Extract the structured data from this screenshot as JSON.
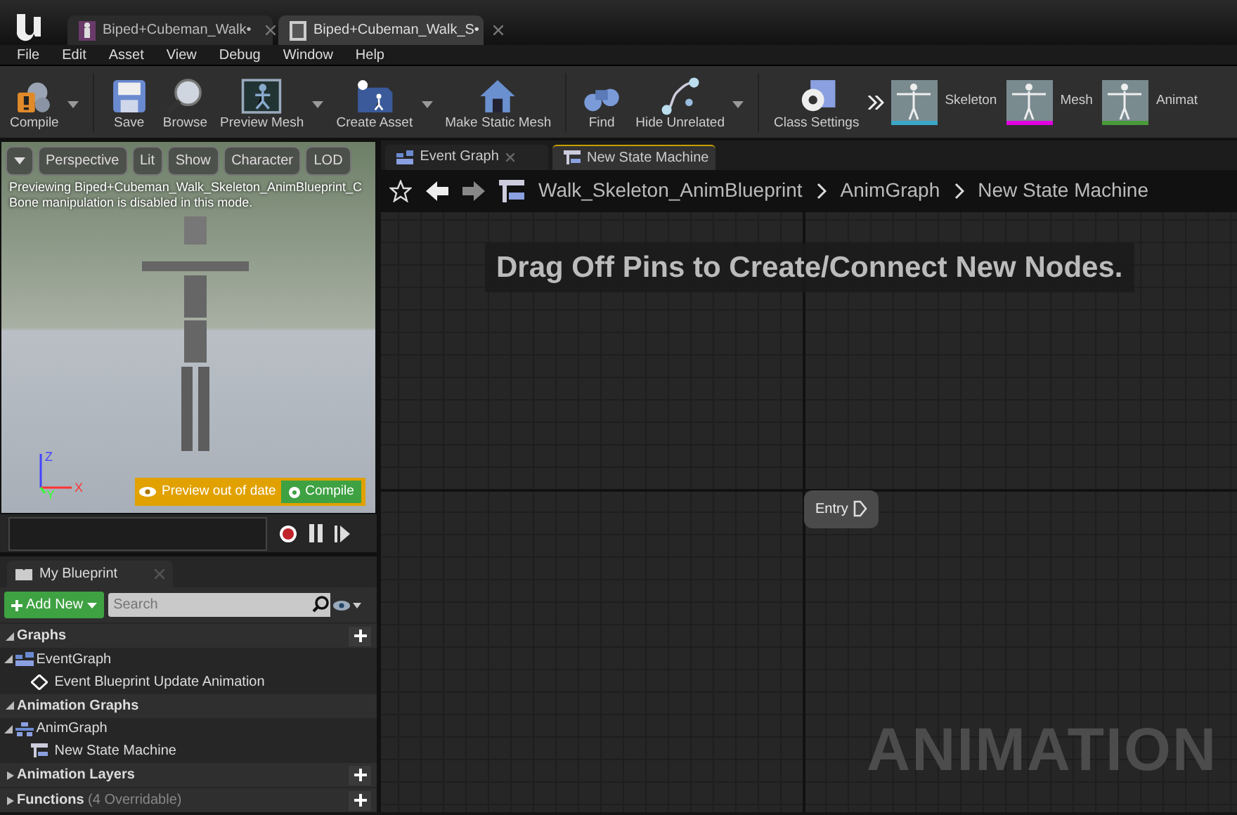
{
  "window": {
    "tabs": [
      {
        "label": "Biped+Cubeman_Walk",
        "modified_mark": "•",
        "selected": false
      },
      {
        "label": "Biped+Cubeman_Walk_S",
        "modified_mark": "•",
        "selected": true
      }
    ]
  },
  "menu": [
    "File",
    "Edit",
    "Asset",
    "View",
    "Debug",
    "Window",
    "Help"
  ],
  "toolbar": {
    "buttons": [
      {
        "label": "Compile",
        "dropdown": true
      },
      {
        "label": "Save",
        "dropdown": false
      },
      {
        "label": "Browse",
        "dropdown": false
      },
      {
        "label": "Preview Mesh",
        "dropdown": true
      },
      {
        "label": "Create Asset",
        "dropdown": true
      },
      {
        "label": "Make Static Mesh",
        "dropdown": false
      },
      {
        "label": "Find",
        "dropdown": false
      },
      {
        "label": "Hide Unrelated",
        "dropdown": true
      },
      {
        "label": "Class Settings",
        "dropdown": false
      }
    ],
    "modes": [
      {
        "label": "Skeleton",
        "color": "#3aa6c8"
      },
      {
        "label": "Mesh",
        "color": "#e000e0"
      },
      {
        "label": "Animat",
        "color": "#4a9a3a"
      }
    ]
  },
  "viewport": {
    "buttons": [
      {
        "label": "Perspective"
      },
      {
        "label": "Lit"
      },
      {
        "label": "Show"
      },
      {
        "label": "Character"
      },
      {
        "label": "LOD"
      }
    ],
    "messages": [
      "Previewing Biped+Cubeman_Walk_Skeleton_AnimBlueprint_C",
      "Bone manipulation is disabled in this mode."
    ],
    "axes": [
      "Z",
      "X",
      "Y"
    ],
    "warning": "Preview out of date",
    "compile_button": "Compile"
  },
  "my_blueprint": {
    "tab": "My Blueprint",
    "add_button": "Add New",
    "search": {
      "placeholder": "Search"
    },
    "sections": [
      {
        "label": "Graphs",
        "expanded": true,
        "addable": true,
        "children": [
          {
            "label": "EventGraph",
            "expanded": true,
            "children": [
              {
                "label": "Event Blueprint Update Animation"
              }
            ]
          }
        ]
      },
      {
        "label": "Animation Graphs",
        "expanded": true,
        "addable": false,
        "children": [
          {
            "label": "AnimGraph",
            "expanded": true,
            "children": [
              {
                "label": "New State Machine"
              }
            ]
          }
        ]
      },
      {
        "label": "Animation Layers",
        "expanded": false,
        "addable": true
      },
      {
        "label": "Functions",
        "note": "(4 Overridable)",
        "expanded": false,
        "addable": true
      }
    ]
  },
  "graph": {
    "tabs": [
      {
        "label": "Event Graph",
        "selected": false
      },
      {
        "label": "New State Machine",
        "selected": true
      }
    ],
    "breadcrumbs": [
      "Walk_Skeleton_AnimBlueprint",
      "AnimGraph",
      "New State Machine"
    ],
    "hint": "Drag Off Pins to Create/Connect New Nodes.",
    "node": "Entry",
    "watermark": "ANIMATION"
  }
}
